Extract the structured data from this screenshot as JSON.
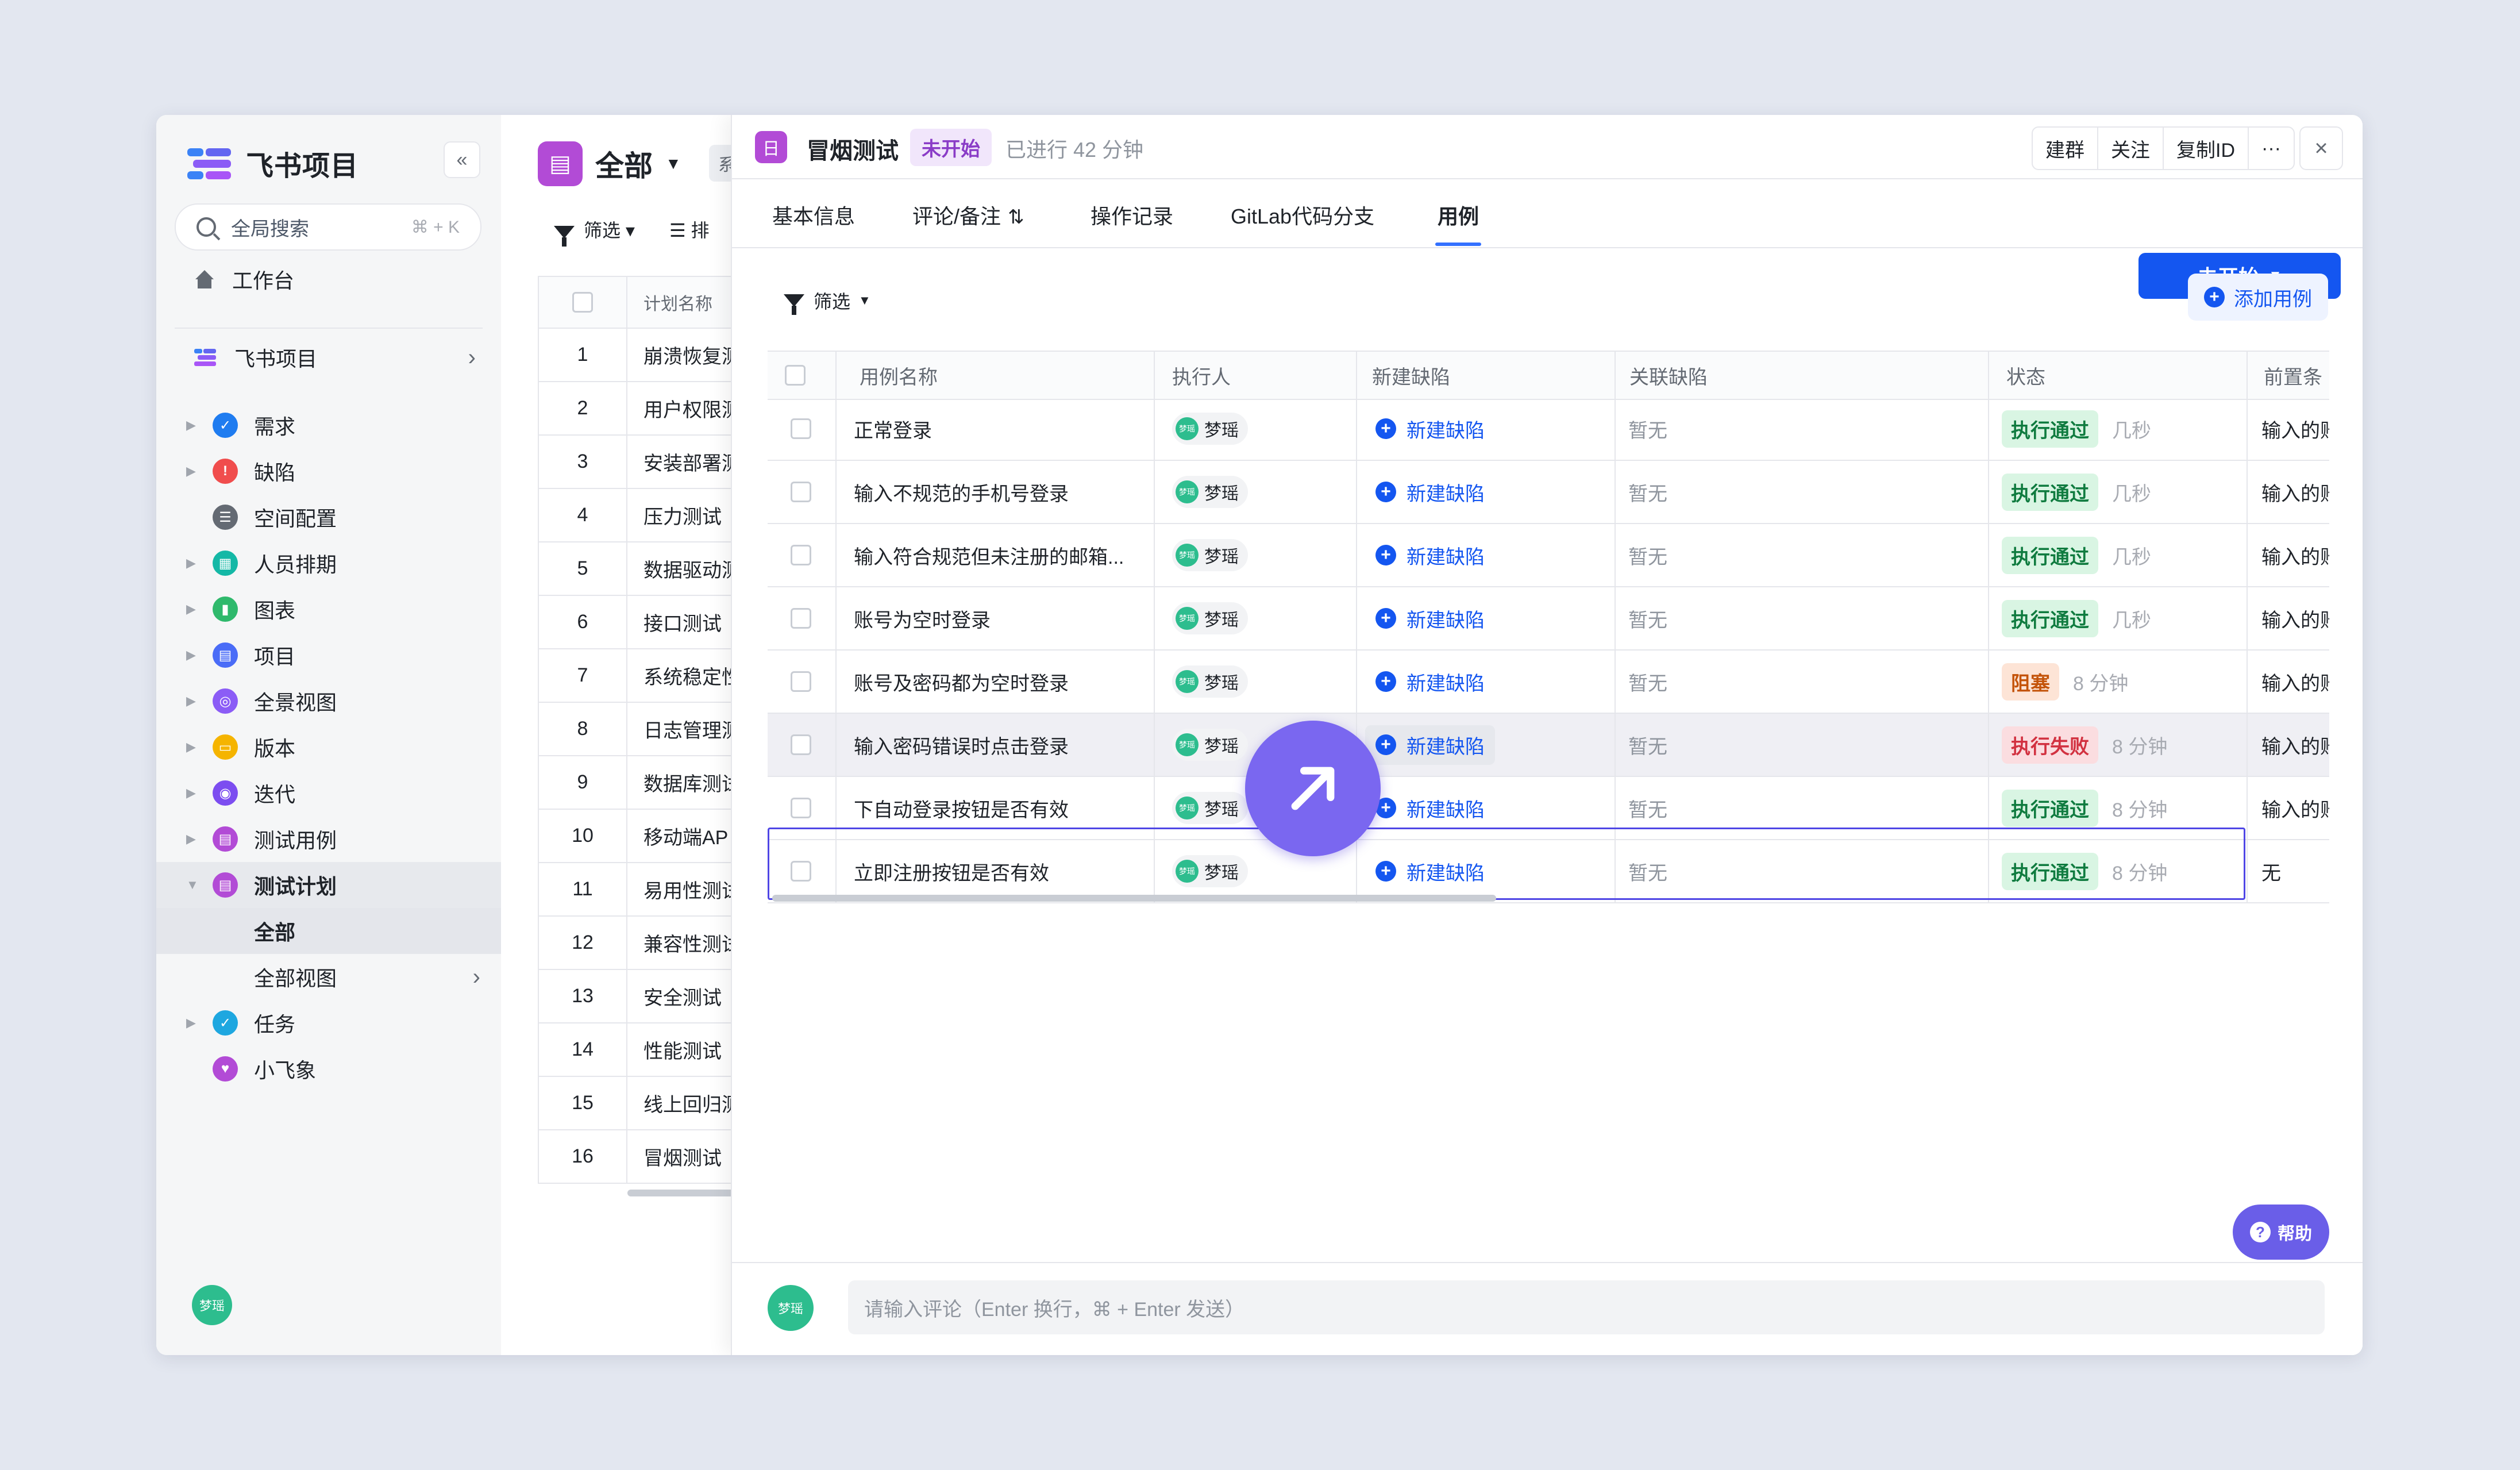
{
  "sidebar": {
    "brand": "飞书项目",
    "collapse_icon": "«",
    "search_label": "全局搜索",
    "search_shortcut": "⌘ + K",
    "workbench": "工作台",
    "project": "飞书项目",
    "items": [
      {
        "label": "需求",
        "color": "#1f7cf0"
      },
      {
        "label": "缺陷",
        "color": "#f04d4d"
      },
      {
        "label": "空间配置",
        "color": "#646a73"
      },
      {
        "label": "人员排期",
        "color": "#14b8a6"
      },
      {
        "label": "图表",
        "color": "#2fb96c"
      },
      {
        "label": "项目",
        "color": "#4a6cf7"
      },
      {
        "label": "全景视图",
        "color": "#8b5cf6"
      },
      {
        "label": "版本",
        "color": "#f5b400"
      },
      {
        "label": "迭代",
        "color": "#7c4df0"
      },
      {
        "label": "测试用例",
        "color": "#b24bd6"
      },
      {
        "label": "测试计划",
        "color": "#b24bd6"
      },
      {
        "label": "全部"
      },
      {
        "label": "全部视图"
      },
      {
        "label": "任务",
        "color": "#1ea7e0"
      },
      {
        "label": "小飞象",
        "color": "#b24bd6"
      }
    ],
    "avatar": "梦瑶"
  },
  "list": {
    "title": "全部",
    "tag": "系",
    "filter": "筛选",
    "sort": "排",
    "header": "计划名称",
    "rows": [
      {
        "num": "1",
        "name": "崩溃恢复测"
      },
      {
        "num": "2",
        "name": "用户权限测"
      },
      {
        "num": "3",
        "name": "安装部署测"
      },
      {
        "num": "4",
        "name": "压力测试"
      },
      {
        "num": "5",
        "name": "数据驱动测"
      },
      {
        "num": "6",
        "name": "接口测试"
      },
      {
        "num": "7",
        "name": "系统稳定性"
      },
      {
        "num": "8",
        "name": "日志管理测"
      },
      {
        "num": "9",
        "name": "数据库测试"
      },
      {
        "num": "10",
        "name": "移动端AP"
      },
      {
        "num": "11",
        "name": "易用性测试"
      },
      {
        "num": "12",
        "name": "兼容性测试"
      },
      {
        "num": "13",
        "name": "安全测试"
      },
      {
        "num": "14",
        "name": "性能测试"
      },
      {
        "num": "15",
        "name": "线上回归测"
      },
      {
        "num": "16",
        "name": "冒烟测试"
      }
    ]
  },
  "detail": {
    "icon": "日",
    "title": "冒烟测试",
    "status": "未开始",
    "elapsed": "已进行 42 分钟",
    "actions": [
      "建群",
      "关注",
      "复制ID",
      "···"
    ],
    "close": "×",
    "tabs": [
      "基本信息",
      "评论/备注",
      "操作记录",
      "GitLab代码分支",
      "用例"
    ],
    "active_tab": "用例",
    "primary_button": "未开始",
    "filter": "筛选",
    "add_case": "添加用例",
    "columns": [
      "用例名称",
      "执行人",
      "新建缺陷",
      "关联缺陷",
      "状态",
      "前置条"
    ],
    "rows": [
      {
        "name": "正常登录",
        "executor": "梦瑶",
        "new_bug": "新建缺陷",
        "related": "暂无",
        "status": "执行通过",
        "status_type": "pass",
        "time": "几秒",
        "pre": "输入的账"
      },
      {
        "name": "输入不规范的手机号登录",
        "executor": "梦瑶",
        "new_bug": "新建缺陷",
        "related": "暂无",
        "status": "执行通过",
        "status_type": "pass",
        "time": "几秒",
        "pre": "输入的账"
      },
      {
        "name": "输入符合规范但未注册的邮箱...",
        "executor": "梦瑶",
        "new_bug": "新建缺陷",
        "related": "暂无",
        "status": "执行通过",
        "status_type": "pass",
        "time": "几秒",
        "pre": "输入的账"
      },
      {
        "name": "账号为空时登录",
        "executor": "梦瑶",
        "new_bug": "新建缺陷",
        "related": "暂无",
        "status": "执行通过",
        "status_type": "pass",
        "time": "几秒",
        "pre": "输入的账"
      },
      {
        "name": "账号及密码都为空时登录",
        "executor": "梦瑶",
        "new_bug": "新建缺陷",
        "related": "暂无",
        "status": "阻塞",
        "status_type": "block",
        "time": "8 分钟",
        "pre": "输入的账"
      },
      {
        "name": "输入密码错误时点击登录",
        "executor": "梦瑶",
        "new_bug": "新建缺陷",
        "related": "暂无",
        "status": "执行失败",
        "status_type": "fail",
        "time": "8 分钟",
        "pre": "输入的账"
      },
      {
        "name": "下自动登录按钮是否有效",
        "executor": "梦瑶",
        "new_bug": "新建缺陷",
        "related": "暂无",
        "status": "执行通过",
        "status_type": "pass",
        "time": "8 分钟",
        "pre": "输入的账"
      },
      {
        "name": "立即注册按钮是否有效",
        "executor": "梦瑶",
        "new_bug": "新建缺陷",
        "related": "暂无",
        "status": "执行通过",
        "status_type": "pass",
        "time": "8 分钟",
        "pre": "无"
      }
    ],
    "help": "帮助",
    "comment_avatar": "梦瑶",
    "comment_placeholder": "请输入评论（Enter 换行，⌘ + Enter 发送）"
  }
}
